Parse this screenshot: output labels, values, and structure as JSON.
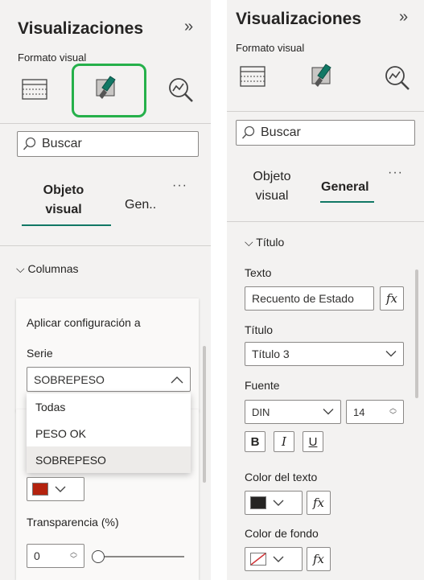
{
  "left": {
    "title": "Visualizaciones",
    "collapse": "»",
    "subtitle": "Formato visual",
    "search_placeholder": "Buscar",
    "tab1": [
      "Objeto",
      "visual"
    ],
    "tab2": "Gen..",
    "more": "···",
    "section": "Columnas",
    "card_title": "Aplicar configuración a",
    "serie_label": "Serie",
    "serie_value": "SOBREPESO",
    "dropdown_options": [
      "Todas",
      "PESO OK",
      "SOBREPESO"
    ],
    "selected_option": "SOBREPESO",
    "swatch_color": "#b4230f",
    "transparency_label": "Transparencia (%)",
    "transparency_value": "0"
  },
  "right": {
    "title": "Visualizaciones",
    "collapse": "»",
    "subtitle": "Formato visual",
    "search_placeholder": "Buscar",
    "tab1": [
      "Objeto",
      "visual"
    ],
    "tab2": "General",
    "more": "···",
    "section": "Título",
    "texto_label": "Texto",
    "texto_value": "Recuento de Estado",
    "fx": "fx",
    "titulo_label": "Título",
    "titulo_value": "Título 3",
    "fuente_label": "Fuente",
    "fuente_value": "DIN",
    "fuente_size": "14",
    "bold": "B",
    "italic": "I",
    "underline": "U",
    "color_texto_label": "Color del texto",
    "color_texto_value": "#252423",
    "color_fondo_label": "Color de fondo"
  },
  "colors": {
    "accent": "#117865",
    "highlight": "#25b04a",
    "panel_bg": "#f3f2f1"
  }
}
